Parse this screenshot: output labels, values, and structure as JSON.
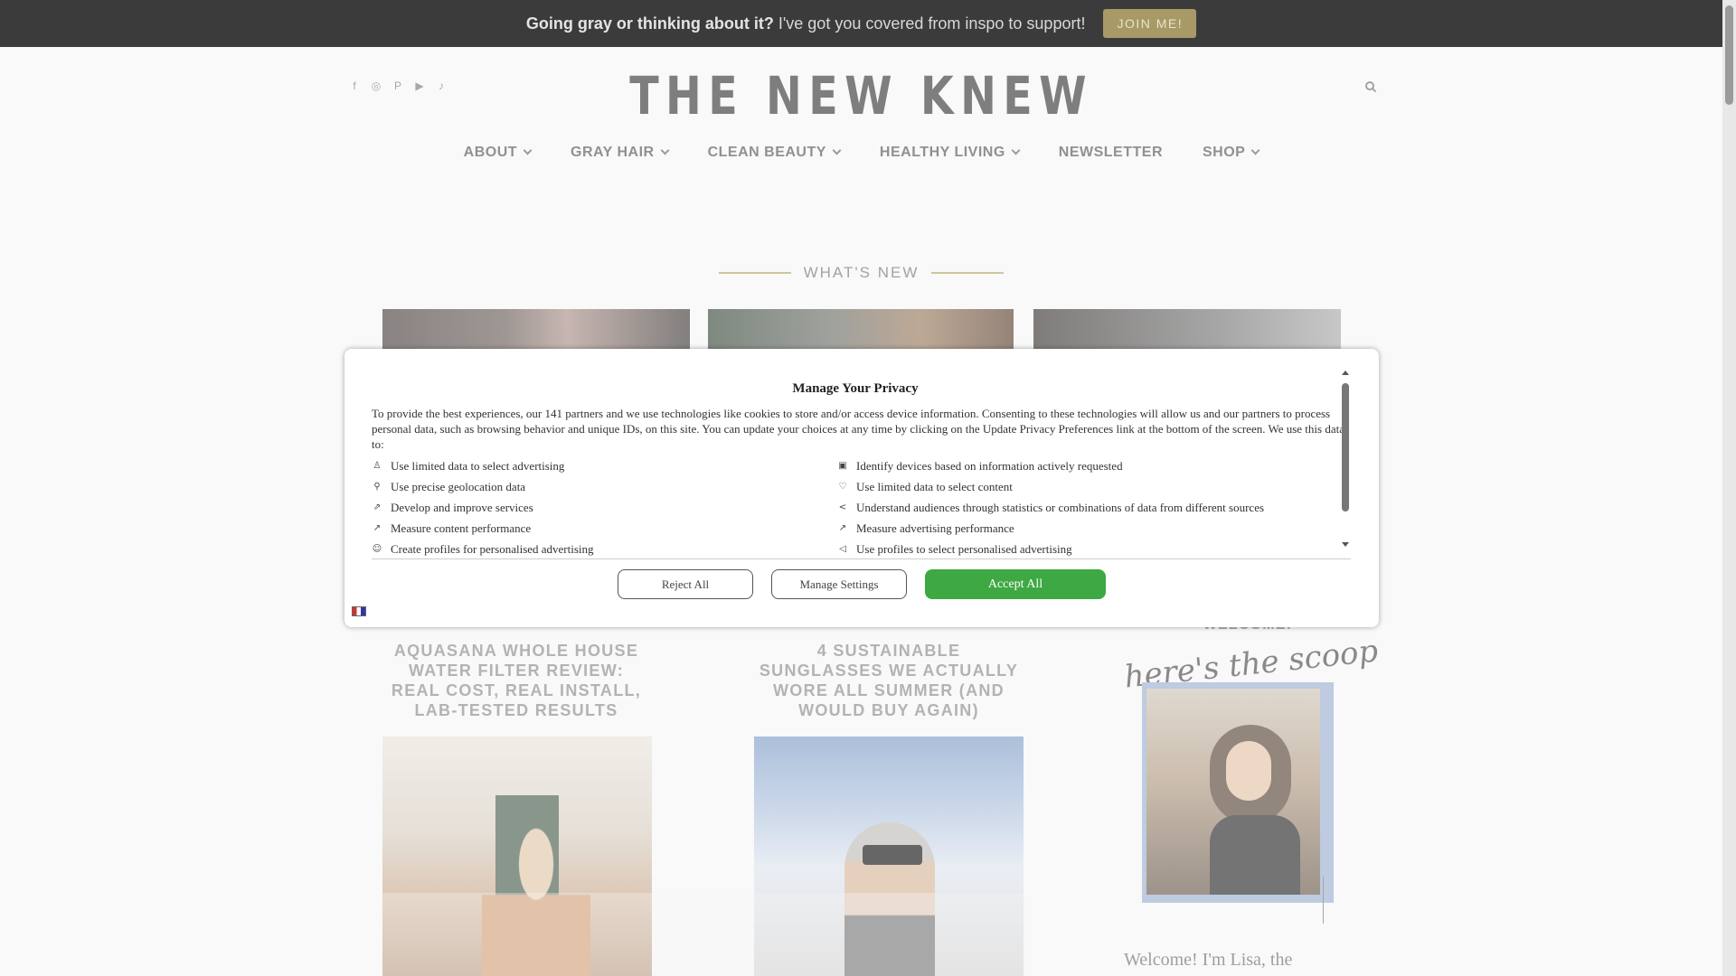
{
  "promo": {
    "bold_text": "Going gray or thinking about it?",
    "text": "I've got you covered from inspo to support!",
    "button": "JOIN ME!"
  },
  "header": {
    "logo": "THE NEW KNEW",
    "social_icons": [
      "facebook-icon",
      "instagram-icon",
      "pinterest-icon",
      "youtube-icon",
      "tiktok-icon"
    ],
    "social_glyphs": [
      "f",
      "◎",
      "P",
      "▶",
      "♪"
    ]
  },
  "nav": {
    "items": [
      {
        "label": "ABOUT",
        "dropdown": true
      },
      {
        "label": "GRAY HAIR",
        "dropdown": true
      },
      {
        "label": "CLEAN BEAUTY",
        "dropdown": true
      },
      {
        "label": "HEALTHY LIVING",
        "dropdown": true
      },
      {
        "label": "NEWSLETTER",
        "dropdown": false
      },
      {
        "label": "SHOP",
        "dropdown": true
      }
    ]
  },
  "main": {
    "section_title": "WHAT'S NEW",
    "posts": [
      {
        "title": "AQUASANA WHOLE HOUSE WATER FILTER REVIEW: REAL COST, REAL INSTALL, LAB-TESTED RESULTS"
      },
      {
        "title": "4 SUSTAINABLE SUNGLASSES WE ACTUALLY WORE ALL SUMMER (AND WOULD BUY AGAIN)"
      }
    ]
  },
  "sidebar": {
    "heading": "WELCOME!",
    "script": "here's the scoop",
    "intro": "Welcome! I'm Lisa, the"
  },
  "privacy": {
    "title": "Manage Your Privacy",
    "intro": "To provide the best experiences, our 141 partners and we use technologies like cookies to store and/or access device information. Consenting to these technologies will allow us and our partners to process personal data, such as browsing behavior and unique IDs, on this site. You can update your choices at any time by clicking on the Update Privacy Preferences link at the bottom of the screen. We use this data to:",
    "purposes": [
      {
        "label": "Use limited data to select advertising",
        "icon": "user-icon",
        "glyph": "♙"
      },
      {
        "label": "Identify devices based on information actively requested",
        "icon": "device-icon",
        "glyph": "▣"
      },
      {
        "label": "Use precise geolocation data",
        "icon": "location-pin-icon",
        "glyph": "⚲"
      },
      {
        "label": "Use limited data to select content",
        "icon": "heart-icon",
        "glyph": "♡"
      },
      {
        "label": "Develop and improve services",
        "icon": "rocket-icon",
        "glyph": "⇗"
      },
      {
        "label": "Understand audiences through statistics or combinations of data from different sources",
        "icon": "share-icon",
        "glyph": "<"
      },
      {
        "label": "Measure content performance",
        "icon": "trend-icon",
        "glyph": "↗"
      },
      {
        "label": "Measure advertising performance",
        "icon": "trend-icon",
        "glyph": "↗"
      },
      {
        "label": "Create profiles for personalised advertising",
        "icon": "profile-icon",
        "glyph": "☺"
      },
      {
        "label": "Use profiles to select personalised advertising",
        "icon": "megaphone-icon",
        "glyph": "◁"
      }
    ],
    "reject": "Reject All",
    "manage": "Manage Settings",
    "accept": "Accept All"
  }
}
